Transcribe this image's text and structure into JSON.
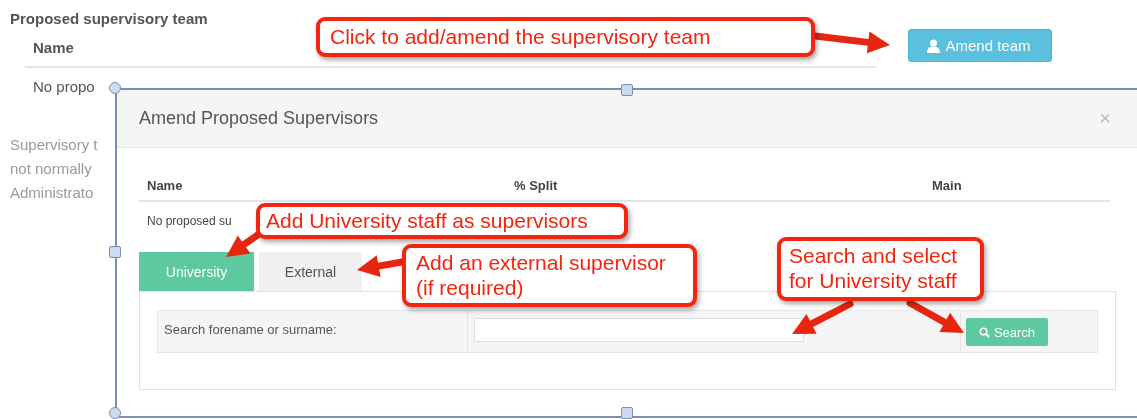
{
  "page": {
    "heading": "Proposed supervisory team",
    "table_header": "Name",
    "empty_row": "No propo",
    "note_lines": [
      "Supervisory t",
      "not normally",
      "Administrato"
    ],
    "amend_button": "Amend team"
  },
  "modal": {
    "title": "Amend Proposed Supervisors",
    "close": "×",
    "columns": [
      "Name",
      "% Split",
      "Main"
    ],
    "empty_row": "No proposed su",
    "tabs": [
      {
        "label": "University",
        "selected": true
      },
      {
        "label": "External",
        "selected": false
      }
    ],
    "search_label": "Search forename or surname:",
    "search_button": "Search"
  },
  "callouts": [
    {
      "lines": [
        "Click to add/amend the supervisory team"
      ]
    },
    {
      "lines": [
        "Add University staff as supervisors"
      ]
    },
    {
      "lines": [
        "Add an external supervisor",
        "(if required)"
      ]
    },
    {
      "lines": [
        "Search and select",
        "for University staff"
      ]
    }
  ]
}
